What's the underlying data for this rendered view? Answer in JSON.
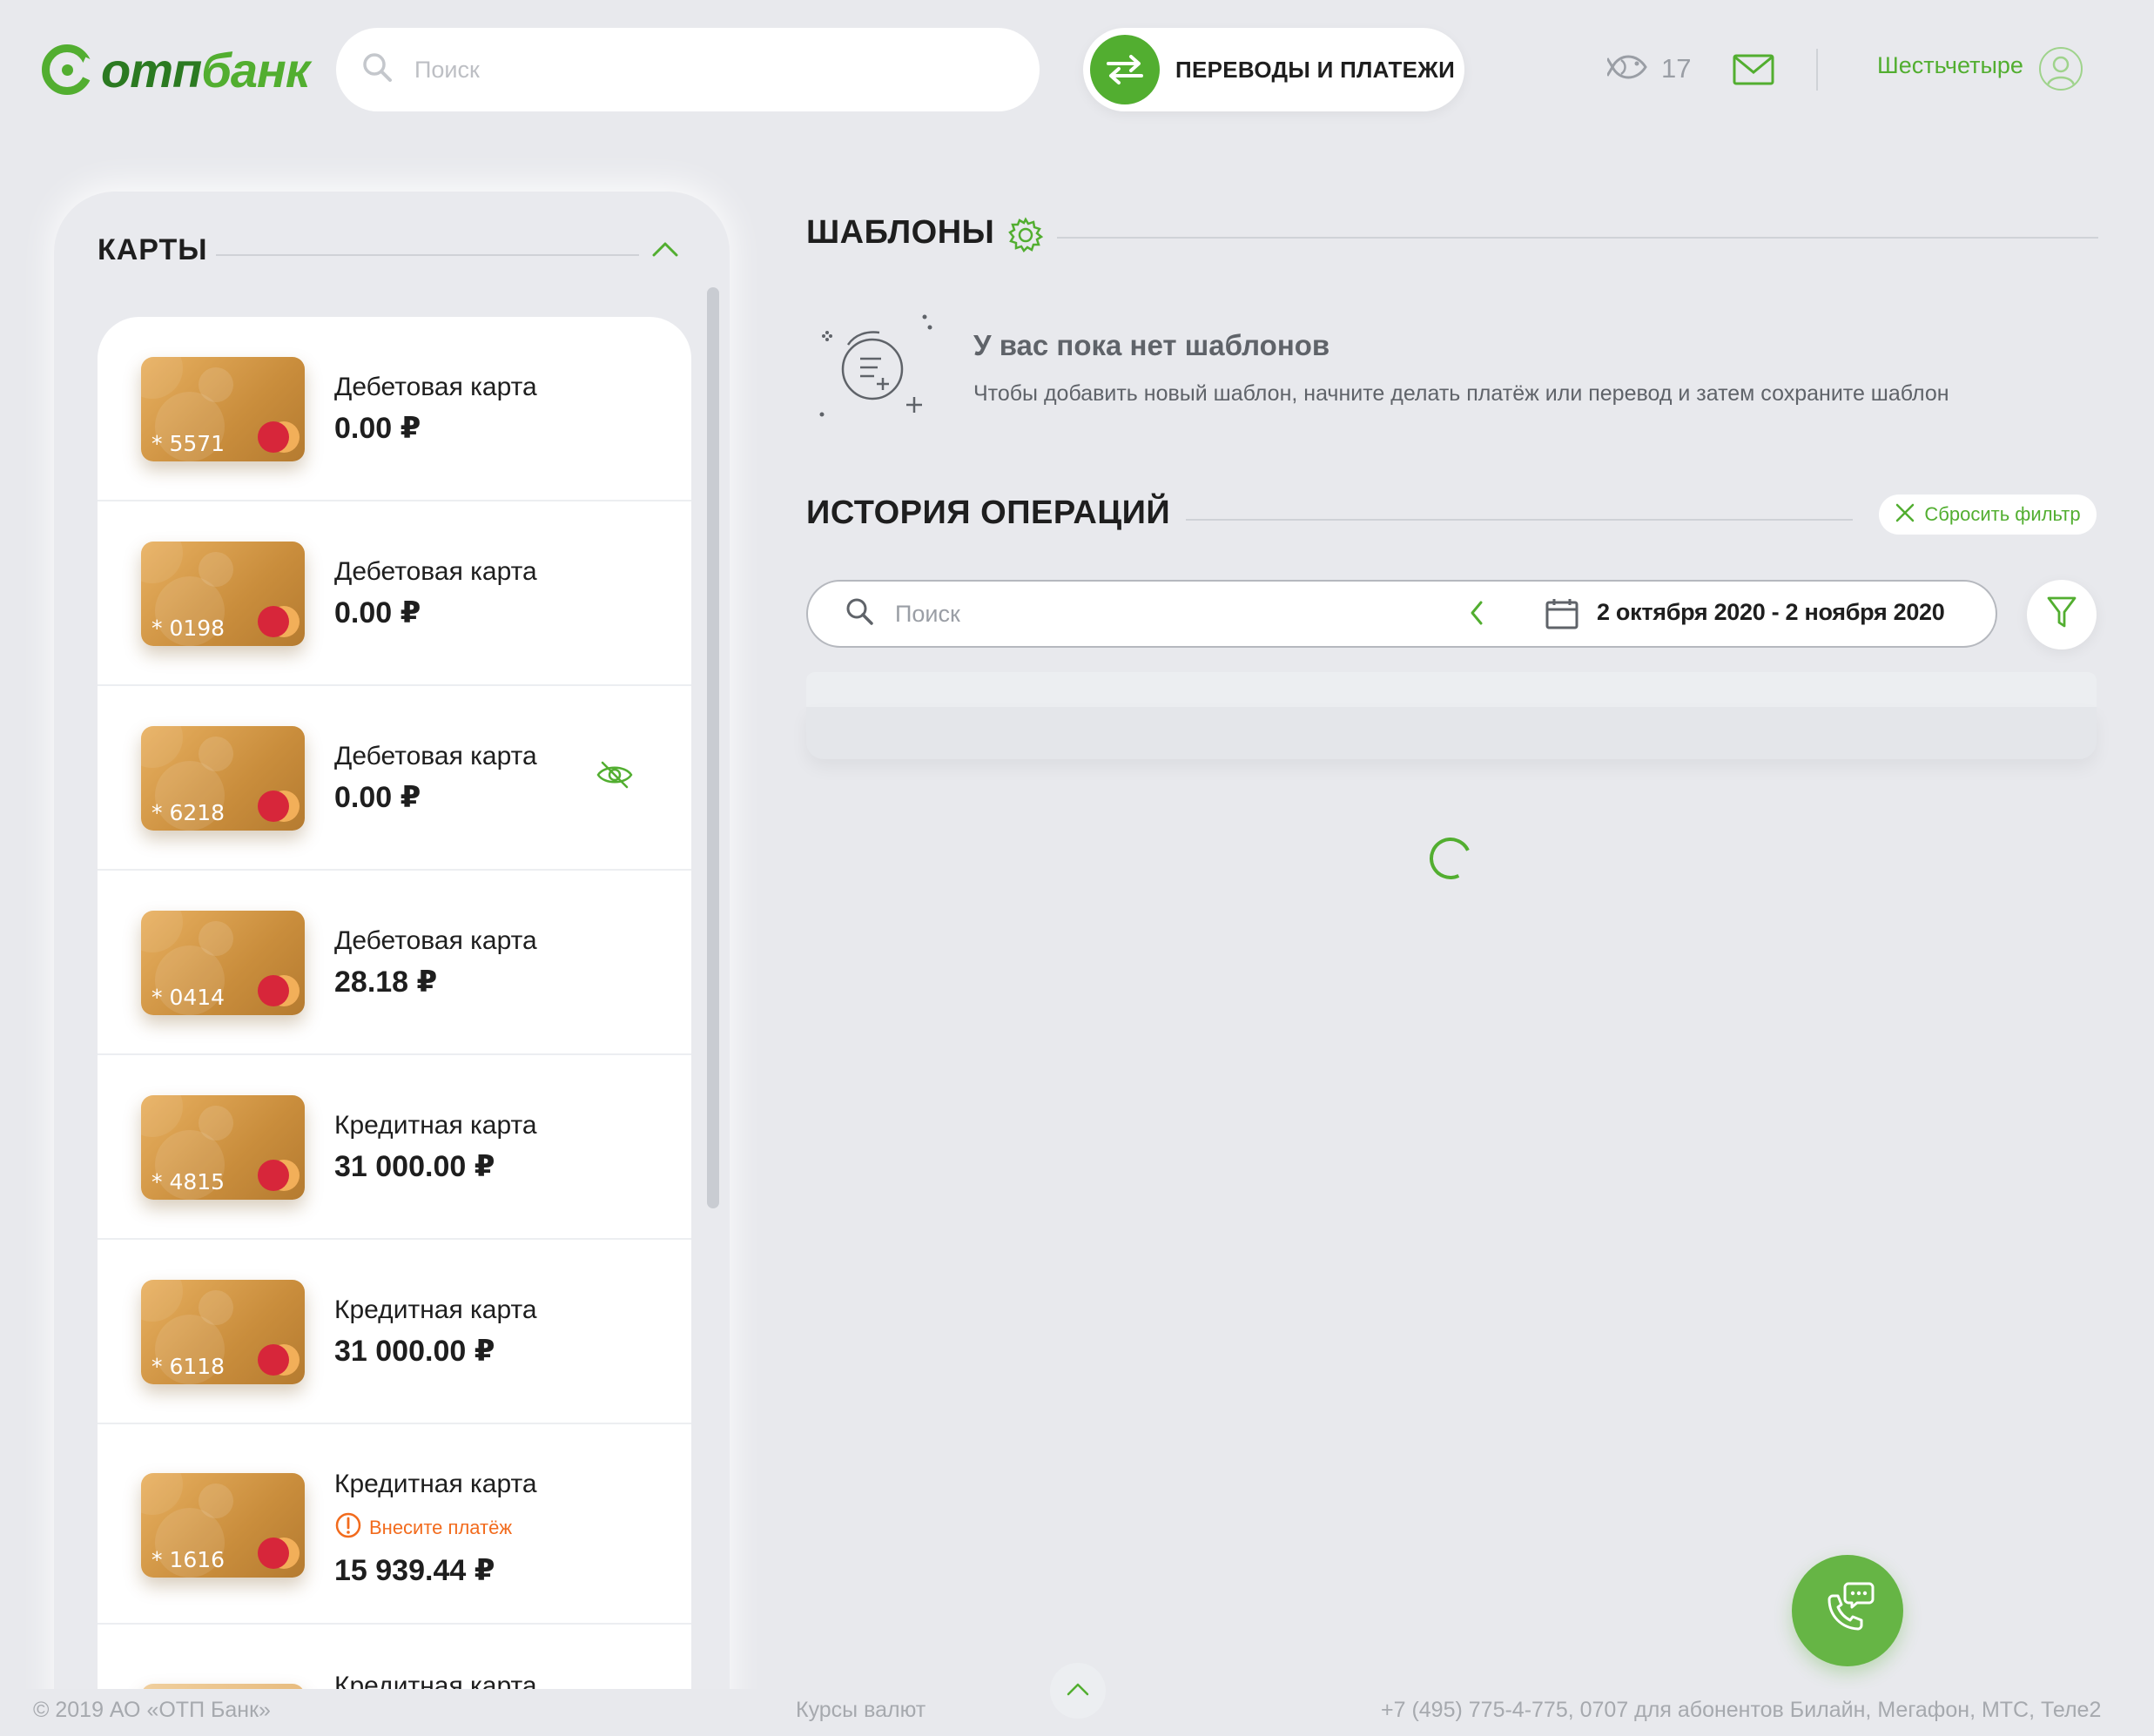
{
  "brand": {
    "logo_text_a": "отп",
    "logo_text_b": "банк",
    "accent": "#52ae30",
    "warning": "#f26b1d"
  },
  "header": {
    "search_placeholder": "Поиск",
    "transfer_label": "ПЕРЕВОДЫ И ПЛАТЕЖИ",
    "bonus_count": "17",
    "user_name": "Шестьчетыре"
  },
  "cards": {
    "title": "КАРТЫ",
    "items": [
      {
        "name": "Дебетовая карта",
        "amount": "0.00 ₽",
        "number": "* 5571"
      },
      {
        "name": "Дебетовая карта",
        "amount": "0.00 ₽",
        "number": "* 0198"
      },
      {
        "name": "Дебетовая карта",
        "amount": "0.00 ₽",
        "number": "* 6218"
      },
      {
        "name": "Дебетовая карта",
        "amount": "28.18 ₽",
        "number": "* 0414"
      },
      {
        "name": "Кредитная карта",
        "amount": "31 000.00 ₽",
        "number": "* 4815"
      },
      {
        "name": "Кредитная карта",
        "amount": "31 000.00 ₽",
        "number": "* 6118"
      },
      {
        "name": "Кредитная карта",
        "amount": "15 939.44 ₽",
        "number": "* 1616",
        "warning": "Внесите платёж"
      },
      {
        "name": "Кредитная карта"
      }
    ]
  },
  "templates": {
    "title": "ШАБЛОНЫ",
    "empty_title": "У вас пока нет шаблонов",
    "empty_subtitle": "Чтобы добавить новый шаблон, начните делать платёж или перевод и затем сохраните шаблон"
  },
  "history": {
    "title": "ИСТОРИЯ ОПЕРАЦИЙ",
    "reset_label": "Сбросить фильтр",
    "search_placeholder": "Поиск",
    "date_range": "2 октября 2020 - 2 ноября 2020"
  },
  "footer": {
    "copyright": "© 2019 АО «ОТП Банк»",
    "rates": "Курсы валют",
    "phone": "+7 (495) 775-4-775,  0707 для абонентов Билайн, Мегафон, МТС, Теле2"
  }
}
